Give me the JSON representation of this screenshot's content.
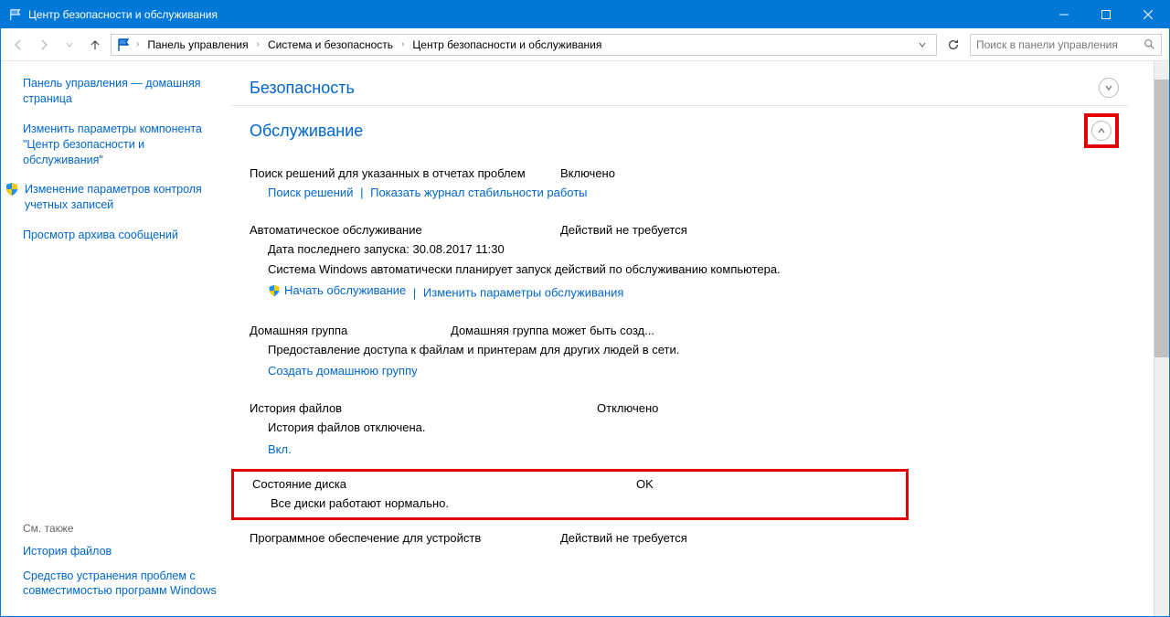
{
  "titlebar": {
    "title": "Центр безопасности и обслуживания"
  },
  "breadcrumb": {
    "items": [
      "Панель управления",
      "Система и безопасность",
      "Центр безопасности и обслуживания"
    ]
  },
  "search": {
    "placeholder": "Поиск в панели управления"
  },
  "sidebar": {
    "home": "Панель управления — домашняя страница",
    "links": [
      "Изменить параметры компонента \"Центр безопасности и обслуживания\"",
      "Изменение параметров контроля учетных записей",
      "Просмотр архива сообщений"
    ],
    "see_also_label": "См. также",
    "bottom": [
      "История файлов",
      "Средство устранения проблем с совместимостью программ Windows"
    ]
  },
  "sections": {
    "security": {
      "title": "Безопасность"
    },
    "maintenance": {
      "title": "Обслуживание",
      "report": {
        "label": "Поиск решений для указанных в отчетах проблем",
        "status": "Включено",
        "link1": "Поиск решений",
        "link2": "Показать журнал стабильности работы"
      },
      "auto": {
        "label": "Автоматическое обслуживание",
        "status": "Действий не требуется",
        "sub1": "Дата последнего запуска: 30.08.2017 11:30",
        "sub2": "Система Windows автоматически планирует запуск действий по обслуживанию компьютера.",
        "link1": "Начать обслуживание",
        "link2": "Изменить параметры обслуживания"
      },
      "homegroup": {
        "label": "Домашняя группа",
        "status": "Домашняя группа может быть созд...",
        "sub": "Предоставление доступа к файлам и принтерам для других людей в сети.",
        "link": "Создать домашнюю группу"
      },
      "filehistory": {
        "label": "История файлов",
        "status": "Отключено",
        "sub": "История файлов отключена.",
        "link": "Вкл."
      },
      "disk": {
        "label": "Состояние диска",
        "status": "OK",
        "sub": "Все диски работают нормально."
      },
      "devicesw": {
        "label": "Программное обеспечение для устройств",
        "status": "Действий не требуется"
      }
    }
  }
}
